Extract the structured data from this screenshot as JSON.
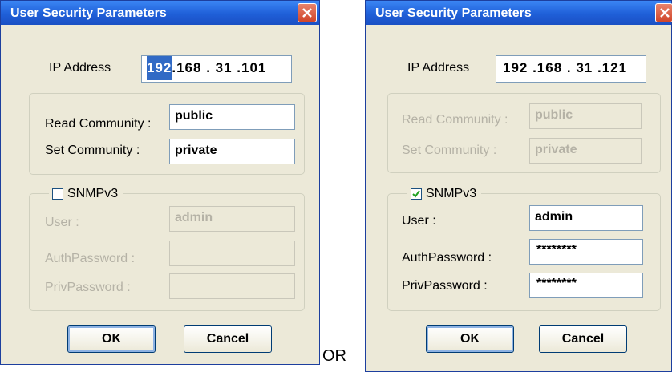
{
  "left_dialog": {
    "title": "User Security Parameters",
    "ip_label": "IP Address",
    "ip_segments": [
      "192",
      ".168",
      ". 31",
      ".101"
    ],
    "read_community_label": "Read Community :",
    "read_community_value": "public",
    "set_community_label": "Set Community :",
    "set_community_value": "private",
    "snmpv3_label": "SNMPv3",
    "snmpv3_checked": false,
    "user_label": "User :",
    "user_value": "admin",
    "auth_label": "AuthPassword :",
    "auth_value": "",
    "priv_label": "PrivPassword :",
    "priv_value": "",
    "ok_label": "OK",
    "cancel_label": "Cancel"
  },
  "right_dialog": {
    "title": "User Security Parameters",
    "ip_label": "IP Address",
    "ip_value": "192 .168 . 31 .121",
    "read_community_label": "Read Community :",
    "read_community_value": "public",
    "set_community_label": "Set Community :",
    "set_community_value": "private",
    "snmpv3_label": "SNMPv3",
    "snmpv3_checked": true,
    "user_label": "User :",
    "user_value": "admin",
    "auth_label": "AuthPassword :",
    "auth_value": "********",
    "priv_label": "PrivPassword :",
    "priv_value": "********",
    "ok_label": "OK",
    "cancel_label": "Cancel"
  },
  "separator_text": "OR",
  "colors": {
    "titlebar": "#1f5fd8",
    "dialog_bg": "#ece9d8",
    "close_button": "#d0452a",
    "selection": "#316ac5"
  }
}
